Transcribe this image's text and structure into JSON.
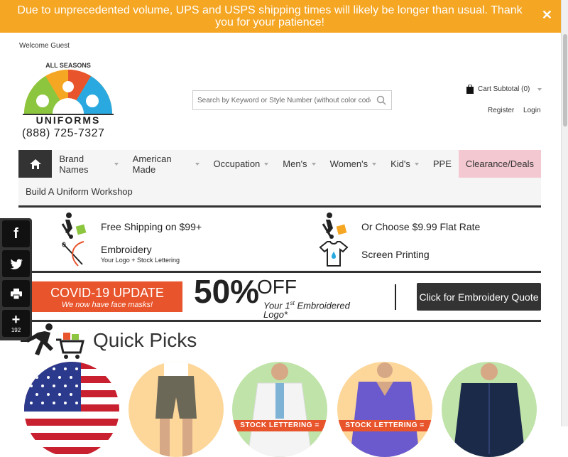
{
  "banner": {
    "message": "Due to unprecedented volume, UPS and USPS shipping times will likely be longer than usual. Thank you for your patience!",
    "close_icon": "close-icon"
  },
  "header": {
    "welcome": "Welcome Guest",
    "logo_text": "ALL SEASONS",
    "logo_sub": "UNIFORMS",
    "phone": "(888) 725-7327",
    "search_placeholder": "Search by Keyword or Style Number (without color code)...",
    "cart_label": "Cart Subtotal (0)",
    "register": "Register",
    "login": "Login"
  },
  "nav": {
    "items": [
      "Brand Names",
      "American Made",
      "Occupation",
      "Men's",
      "Women's",
      "Kid's",
      "PPE",
      "Clearance/Deals"
    ],
    "row2": "Build A Uniform Workshop"
  },
  "features": {
    "free_shipping": "Free Shipping on $99+",
    "flat_rate": "Or Choose $9.99 Flat Rate",
    "embroidery": "Embroidery",
    "embroidery_sub": "Your Logo + Stock Lettering",
    "screen_printing": "Screen Printing"
  },
  "promo": {
    "covid_title": "COVID-19 UPDATE",
    "covid_sub": "We now have face masks!",
    "percent": "50%",
    "off": "OFF",
    "first_pre": "Your 1",
    "first_sup": "st",
    "first_post": " Embroidered Logo*",
    "quote_button": "Click for Embroidery Quote"
  },
  "social": {
    "share_count": "192"
  },
  "quick_picks": {
    "title": "Quick Picks",
    "stock_label": "STOCK LETTERING ="
  },
  "colors": {
    "banner": "#f5a623",
    "clearance": "#f4c8d1",
    "accent": "#e8542b",
    "dark": "#333333"
  }
}
